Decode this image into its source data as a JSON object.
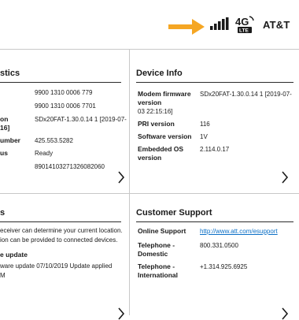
{
  "status_bar": {
    "carrier": "AT&T",
    "network_badge_top": "4G",
    "network_badge_bottom": "LTE",
    "colors": {
      "arrow": "#f5a623",
      "text": "#1a1a1a"
    },
    "icons": [
      "arrow-right-icon",
      "signal-bars-icon",
      "4g-lte-icon"
    ]
  },
  "left_top_card": {
    "title": "stics",
    "labels": [
      "on",
      "16]",
      "umber",
      "us"
    ],
    "values": [
      "9900 1310 0006 779",
      "9900 1310 0006 7701",
      "SDx20FAT-1.30.0.14 1 [2019-07-",
      "425.553.5282",
      "Ready",
      "89014103271326082060"
    ]
  },
  "device_info": {
    "title": "Device Info",
    "rows": [
      {
        "label_lines": [
          "Modem firmware",
          "version"
        ],
        "value": "SDx20FAT-1.30.0.14 1 [2019-07-",
        "continuation": "03 22:15:16]"
      },
      {
        "label_lines": [
          "PRI version"
        ],
        "value": "116"
      },
      {
        "label_lines": [
          "Software version"
        ],
        "value": "1V"
      },
      {
        "label_lines": [
          "Embedded OS",
          "version"
        ],
        "value": "2.114.0.17"
      }
    ]
  },
  "left_bottom_card": {
    "title": "s",
    "lines": [
      "eceiver can determine your current location.",
      "ion can be provided to connected devices."
    ],
    "update_heading": "e update",
    "update_lines": [
      "ware update 07/10/2019 Update applied",
      "M"
    ]
  },
  "customer_support": {
    "title": "Customer Support",
    "rows": [
      {
        "label_lines": [
          "Online Support"
        ],
        "value": "http://www.att.com/esupport"
      },
      {
        "label_lines": [
          "Telephone -",
          "Domestic"
        ],
        "value": "800.331.0500"
      },
      {
        "label_lines": [
          "Telephone -",
          "International"
        ],
        "value": "+1.314.925.6925"
      }
    ]
  }
}
